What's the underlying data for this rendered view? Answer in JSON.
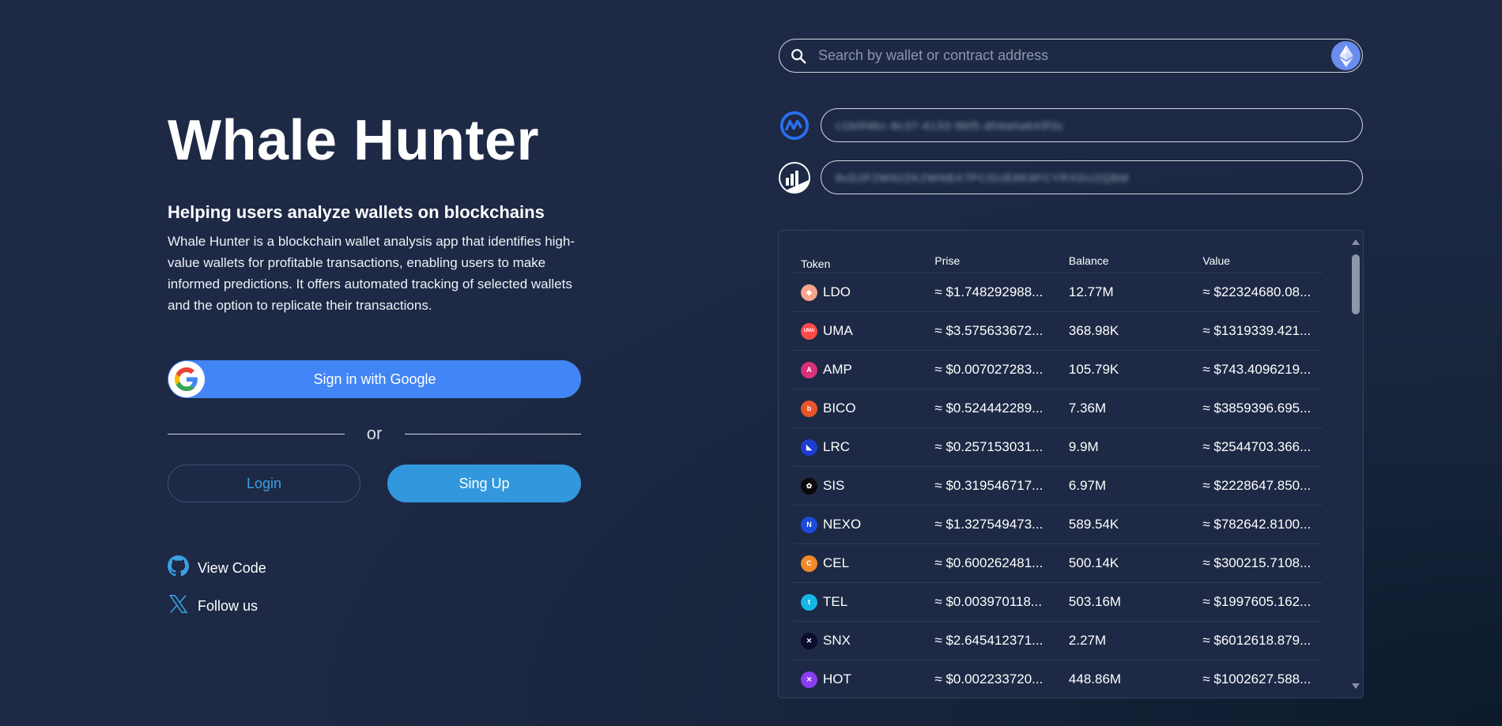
{
  "hero": {
    "title": "Whale Hunter",
    "subtitle": "Helping users analyze wallets on blockchains",
    "description": "Whale Hunter is a blockchain wallet analysis app that identifies high-value wallets for profitable transactions, enabling users to make informed predictions. It offers automated tracking of selected wallets and the option to replicate their transactions."
  },
  "auth": {
    "google_label": "Sign in with Google",
    "or_label": "or",
    "login_label": "Login",
    "signup_label": "Sing Up"
  },
  "links": {
    "view_code": "View Code",
    "follow_us": "Follow us"
  },
  "search": {
    "placeholder": "Search by wallet or contract address",
    "value": ""
  },
  "api_keys": {
    "coinmarketcap_key": "c1b0f4bc-8c37-4133-9bf5-d04a0a643f3c",
    "second_key": "8vD2F2W92ZK2WNBX7PCGUE8K9FCYRXDU2QBM"
  },
  "colors": {
    "background": "#1d2945",
    "google_blue": "#4285f4",
    "signup_blue": "#3297dc",
    "login_text": "#3a9fe3"
  },
  "table": {
    "headers": [
      "Token",
      "Prise",
      "Balance",
      "Value"
    ],
    "rows": [
      {
        "token": "LDO",
        "icon": "ldo-icon",
        "color": "#f4a58a",
        "glyph": "◆",
        "price": "≈ $1.748292988...",
        "balance": "12.77M",
        "value": "≈ $22324680.08..."
      },
      {
        "token": "UMA",
        "icon": "uma-icon",
        "color": "#ff4a4a",
        "glyph": "UMA",
        "price": "≈ $3.575633672...",
        "balance": "368.98K",
        "value": "≈ $1319339.421..."
      },
      {
        "token": "AMP",
        "icon": "amp-icon",
        "color": "#d9307a",
        "glyph": "A",
        "price": "≈ $0.007027283...",
        "balance": "105.79K",
        "value": "≈ $743.4096219..."
      },
      {
        "token": "BICO",
        "icon": "bico-icon",
        "color": "#e8552a",
        "glyph": "b",
        "price": "≈ $0.524442289...",
        "balance": "7.36M",
        "value": "≈ $3859396.695..."
      },
      {
        "token": "LRC",
        "icon": "lrc-icon",
        "color": "#1c3ed1",
        "glyph": "◣",
        "price": "≈ $0.257153031...",
        "balance": "9.9M",
        "value": "≈ $2544703.366..."
      },
      {
        "token": "SIS",
        "icon": "sis-icon",
        "color": "#0a0a0a",
        "glyph": "✿",
        "price": "≈ $0.319546717...",
        "balance": "6.97M",
        "value": "≈ $2228647.850..."
      },
      {
        "token": "NEXO",
        "icon": "nexo-icon",
        "color": "#1a4bdb",
        "glyph": "N",
        "price": "≈ $1.327549473...",
        "balance": "589.54K",
        "value": "≈ $782642.8100..."
      },
      {
        "token": "CEL",
        "icon": "cel-icon",
        "color": "#f08a2a",
        "glyph": "C",
        "price": "≈ $0.600262481...",
        "balance": "500.14K",
        "value": "≈ $300215.7108..."
      },
      {
        "token": "TEL",
        "icon": "tel-icon",
        "color": "#14b7e8",
        "glyph": "t",
        "price": "≈ $0.003970118...",
        "balance": "503.16M",
        "value": "≈ $1997605.162..."
      },
      {
        "token": "SNX",
        "icon": "snx-icon",
        "color": "#0b0b2e",
        "glyph": "✕",
        "price": "≈ $2.645412371...",
        "balance": "2.27M",
        "value": "≈ $6012618.879..."
      },
      {
        "token": "HOT",
        "icon": "hot-icon",
        "color": "#8a3ef0",
        "glyph": "✕",
        "price": "≈ $0.002233720...",
        "balance": "448.86M",
        "value": "≈ $1002627.588..."
      }
    ]
  }
}
